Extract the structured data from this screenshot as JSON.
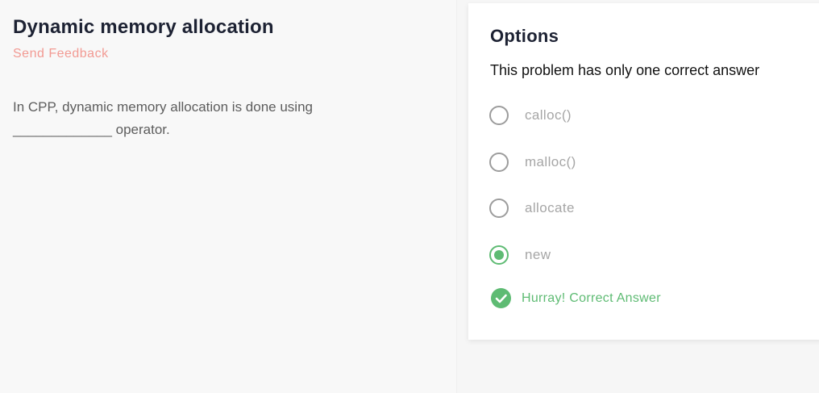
{
  "problem": {
    "title": "Dynamic memory allocation",
    "feedback_label": "Send Feedback",
    "question": "In CPP, dynamic memory allocation is done using _____________ operator."
  },
  "options_panel": {
    "heading": "Options",
    "subtitle": "This problem has only one correct answer",
    "options": [
      {
        "label": "calloc()",
        "selected": false
      },
      {
        "label": "malloc()",
        "selected": false
      },
      {
        "label": "allocate",
        "selected": false
      },
      {
        "label": "new",
        "selected": true
      }
    ],
    "result": {
      "icon": "check-circle-icon",
      "text": "Hurray! Correct Answer"
    }
  },
  "colors": {
    "accent_green": "#5ebb73",
    "feedback_pink": "#f29a93",
    "title_dark": "#1d2233"
  }
}
